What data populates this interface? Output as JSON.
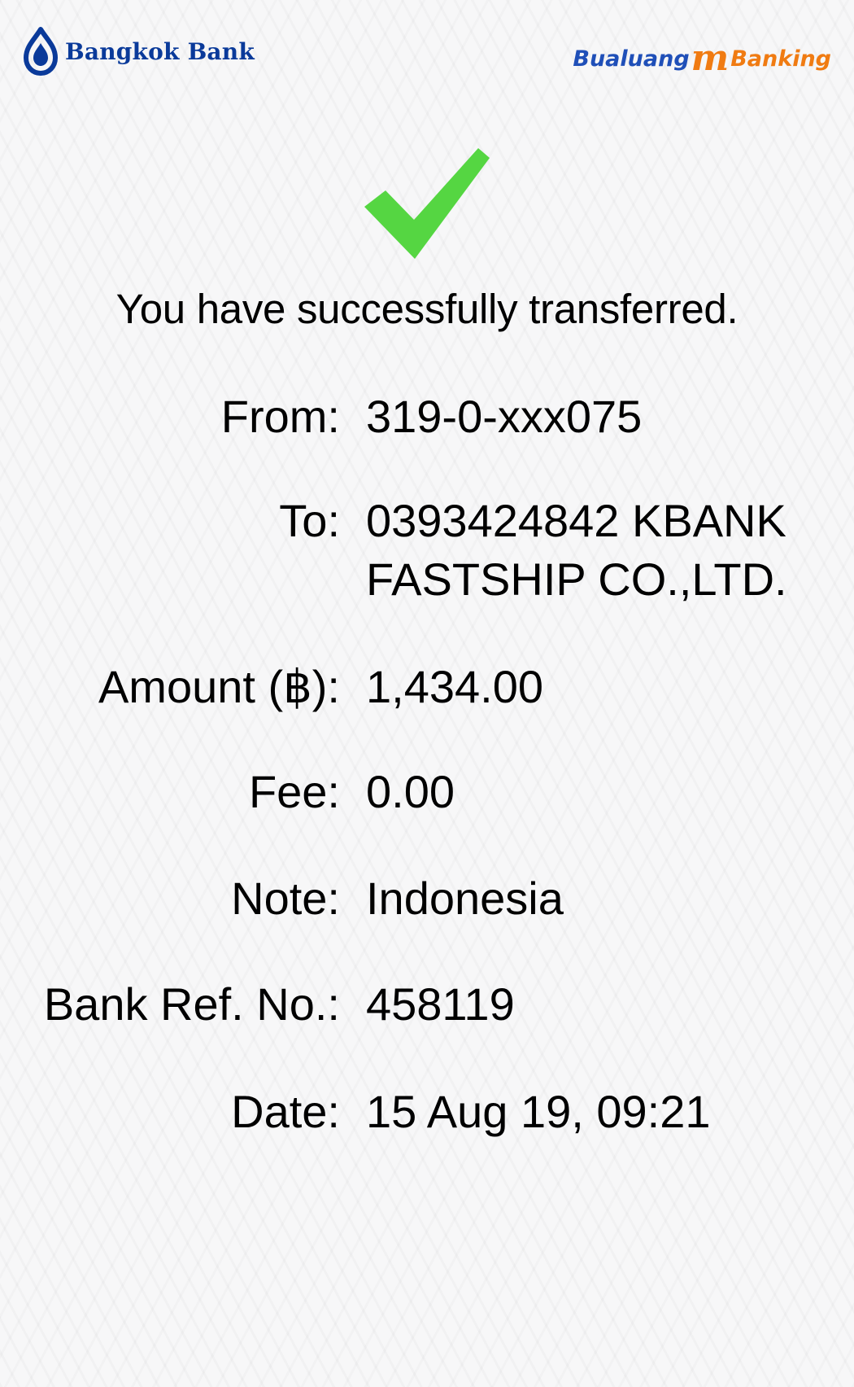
{
  "header": {
    "bank_name": "Bangkok Bank",
    "app_brand_part1": "Bualuang",
    "app_brand_m": "m",
    "app_brand_part2": "Banking",
    "colors": {
      "bank_blue": "#0a3a9a",
      "brand_orange": "#f07b12",
      "check_green": "#55d642"
    }
  },
  "status_message": "You have successfully transferred.",
  "details": [
    {
      "label": "From:",
      "value_lines": [
        "319-0-xxx075"
      ]
    },
    {
      "label": "To:",
      "value_lines": [
        "0393424842 KBANK",
        "FASTSHIP CO.,LTD."
      ]
    },
    {
      "label": "Amount (฿):",
      "value_lines": [
        "1,434.00"
      ]
    },
    {
      "label": "Fee:",
      "value_lines": [
        "0.00"
      ]
    },
    {
      "label": "Note:",
      "value_lines": [
        "Indonesia"
      ]
    },
    {
      "label": "Bank Ref. No.:",
      "value_lines": [
        "458119"
      ]
    },
    {
      "label": "Date:",
      "value_lines": [
        "15 Aug 19, 09:21"
      ]
    }
  ],
  "icons": {
    "success": "check-icon",
    "bank_logo": "bangkok-bank-logo-icon"
  }
}
